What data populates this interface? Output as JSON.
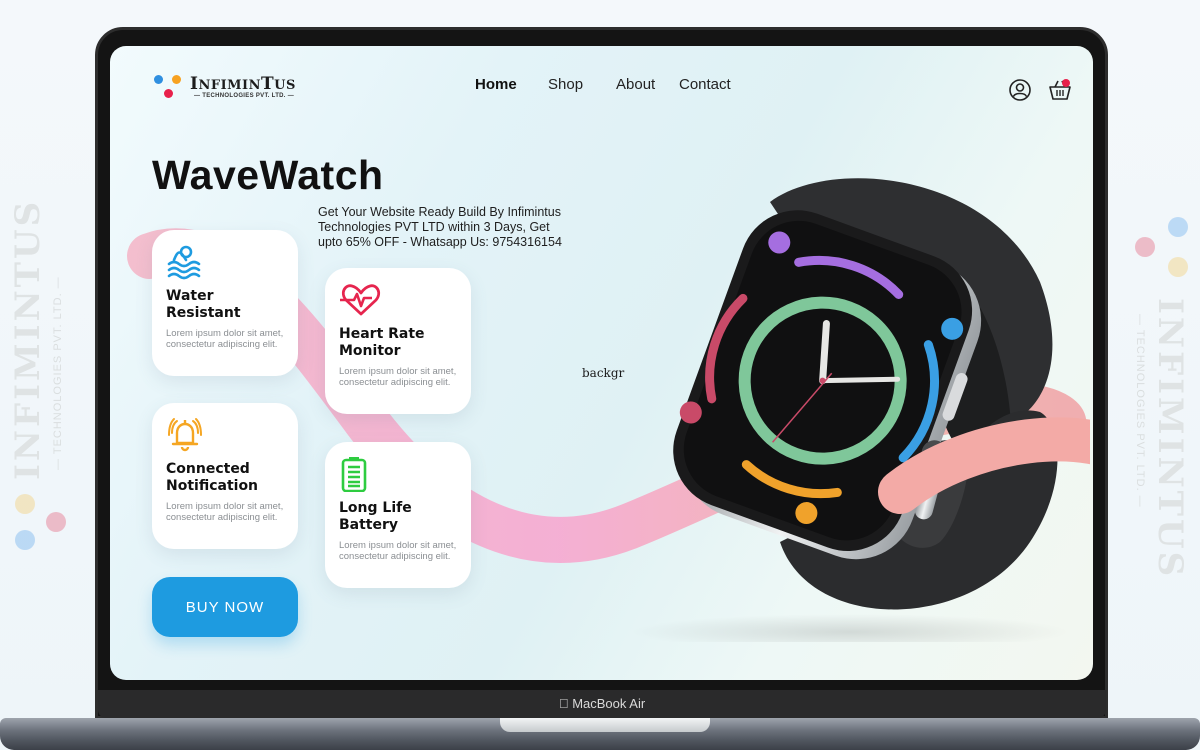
{
  "watermark": {
    "brand": "INFIMINTUS",
    "sub": "— TECHNOLOGIES PVT. LTD. —",
    "dot_colors": [
      "#f3c75d",
      "#e24d6a",
      "#5aa4ea"
    ]
  },
  "device": {
    "label": "MacBook Air"
  },
  "brand": {
    "name_big": "I",
    "name_rest": "NFIMIN",
    "name_t": "T",
    "name_us": "US",
    "tagline": "— TECHNOLOGIES PVT. LTD. —",
    "dot_colors": [
      "#2f8fe0",
      "#f7a221",
      "#e8214b"
    ]
  },
  "nav": {
    "items": [
      {
        "label": "Home",
        "active": true
      },
      {
        "label": "Shop",
        "active": false
      },
      {
        "label": "About",
        "active": false
      },
      {
        "label": "Contact",
        "active": false
      }
    ]
  },
  "header_icons": {
    "account": "user-circle-icon",
    "cart": "basket-icon",
    "cart_badge_color": "#e8214b"
  },
  "hero": {
    "title": "WaveWatch",
    "promo": "Get Your Website Ready Build By Infimintus Technologies PVT LTD within 3 Days, Get upto 65% OFF - Whatsapp Us: 9754316154",
    "stray_text": "backgr"
  },
  "features": [
    {
      "icon": "water-wave-icon",
      "color": "#1e9be0",
      "title": "Water Resistant",
      "desc": "Lorem ipsum dolor sit amet, consectetur adipiscing elit."
    },
    {
      "icon": "heart-rate-icon",
      "color": "#e6254e",
      "title": "Heart Rate Monitor",
      "desc": "Lorem ipsum dolor sit amet, consectetur adipiscing elit."
    },
    {
      "icon": "bell-ringing-icon",
      "color": "#f5a623",
      "title": "Connected Notification",
      "desc": "Lorem ipsum dolor sit amet, consectetur adipiscing elit."
    },
    {
      "icon": "battery-full-icon",
      "color": "#2ecc40",
      "title": "Long Life Battery",
      "desc": "Lorem ipsum dolor sit amet, consectetur adipiscing elit."
    }
  ],
  "cta": {
    "label": "BUY NOW",
    "color": "#1e9be0"
  },
  "watch_face": {
    "ring_colors": {
      "purple": "#a56ee0",
      "blue": "#3a9fe4",
      "green": "#7fc79a",
      "red": "#c94a68",
      "orange": "#f0a22b"
    }
  }
}
